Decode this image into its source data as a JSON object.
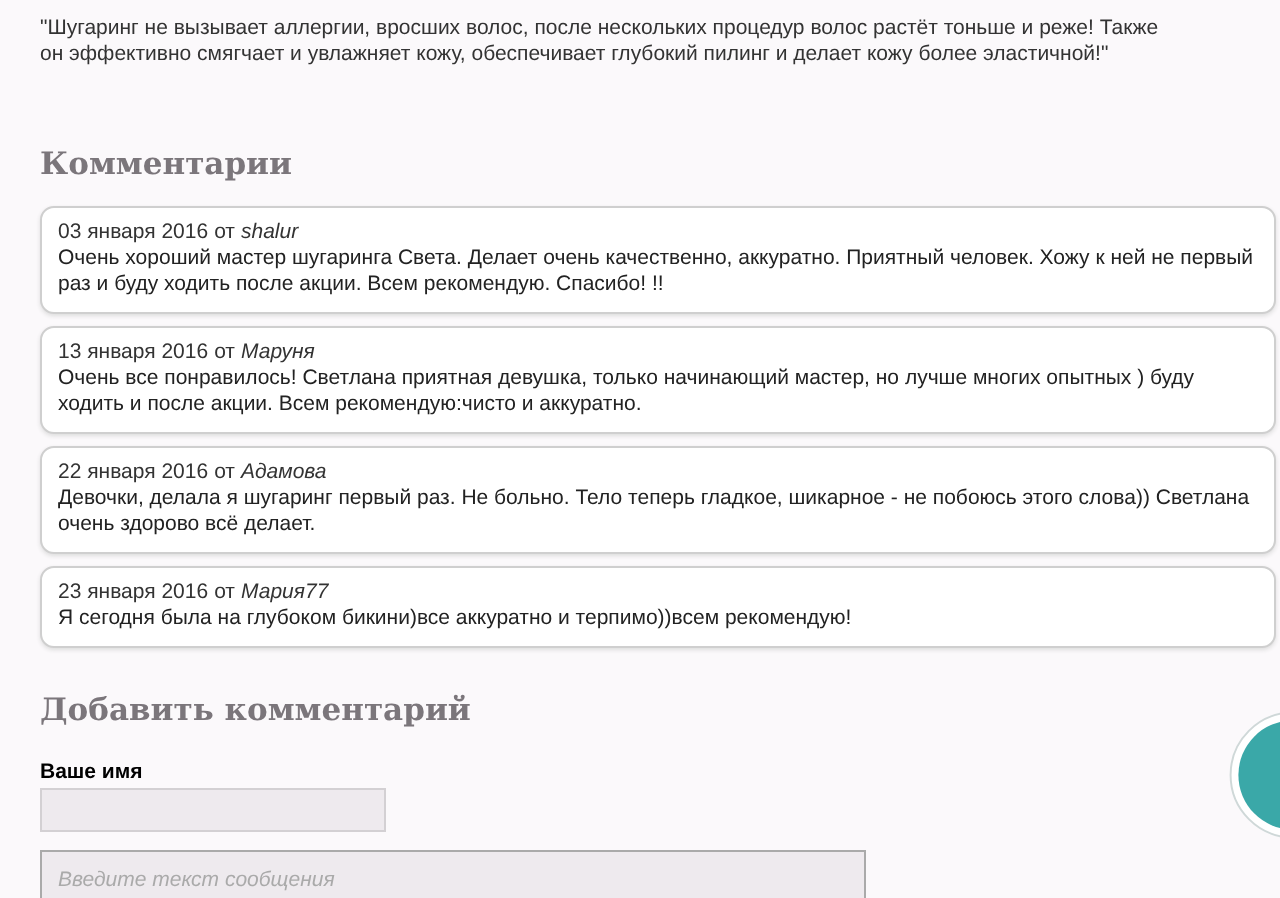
{
  "quote": "\"Шугаринг не вызывает аллергии, вросших волос, после нескольких процедур волос растёт тоньше и реже! Также он эффективно смягчает и увлажняет кожу, обеспечивает глубокий пилинг и делает кожу более эластичной!\"",
  "comments_heading": "Комментарии",
  "comments": [
    {
      "date": "03 января 2016",
      "by": "от",
      "author": "shalur",
      "text": "Очень хороший мастер шугаринга Света. Делает очень качественно, аккуратно. Приятный человек. Хожу к ней не первый раз и буду ходить после акции. Всем рекомендую. Спасибо! !!"
    },
    {
      "date": "13 января 2016",
      "by": "от",
      "author": "Маруня",
      "text": "Очень все понравилось! Светлана приятная девушка, только начинающий мастер, но лучше многих опытных ) буду ходить и после акции. Всем рекомендую:чисто и аккуратно."
    },
    {
      "date": "22 января 2016",
      "by": "от",
      "author": "Адамова",
      "text": "Девочки, делала я шугаринг первый раз. Не больно. Тело теперь гладкое, шикарное - не побоюсь этого слова)) Светлана очень здорово всё делает."
    },
    {
      "date": "23 января 2016",
      "by": "от",
      "author": "Мария77",
      "text": "Я сегодня была на глубоком бикини)все аккуратно и терпимо))всем рекомендую!"
    }
  ],
  "add_heading": "Добавить комментарий",
  "name_label": "Ваше имя",
  "message": {
    "placeholder": "Введите текст сообщения"
  }
}
